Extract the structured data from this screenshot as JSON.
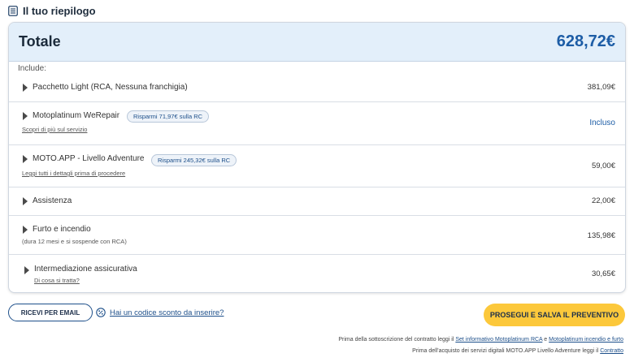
{
  "header": {
    "title": "Il tuo riepilogo"
  },
  "total": {
    "label": "Totale",
    "value": "628,72€"
  },
  "include_label": "Include:",
  "items": [
    {
      "name": "Pacchetto Light (RCA, Nessuna franchigia)",
      "price": "381,09€"
    },
    {
      "name": "Motoplatinum WeRepair",
      "badge": "Risparmi 71,97€ sulla RC",
      "sub": "Scopri di più sul servizio",
      "price": "Incluso"
    },
    {
      "name": "MOTO.APP - Livello Adventure",
      "badge": "Risparmi 245,32€ sulla RC",
      "sub": "Leggi tutti i dettagli prima di procedere",
      "price": "59,00€"
    },
    {
      "name": "Assistenza",
      "price": "22,00€"
    },
    {
      "name": "Furto e incendio",
      "sub": "(dura 12 mesi e si sospende con RCA)",
      "price": "135,98€"
    },
    {
      "name": "Intermediazione assicurativa",
      "sub": "Di cosa si tratta?",
      "price": "30,65€"
    }
  ],
  "actions": {
    "email_button": "RICEVI PER EMAIL",
    "discount_link": "Hai un codice sconto da inserire?",
    "cta_button": "PROSEGUI E SALVA IL PREVENTIVO"
  },
  "legal": {
    "line1_prefix": "Prima della sottoscrizione del contratto leggi il",
    "line1_link1": "Set informativo Motoplatinum RCA",
    "line1_sep": "e",
    "line1_link2": "Motoplatinum incendio e furto",
    "line2_prefix": "Prima dell'acquisto dei servizi digitali MOTO.APP Livello Adventure leggi il",
    "line2_link": "Contratto"
  },
  "colors": {
    "accent_blue": "#1d5da6",
    "header_bg": "#e3effa",
    "cta_yellow": "#fcc83b"
  },
  "icons": {
    "header": "list-icon",
    "row": "caret-right-icon",
    "discount": "percent-badge-icon"
  }
}
